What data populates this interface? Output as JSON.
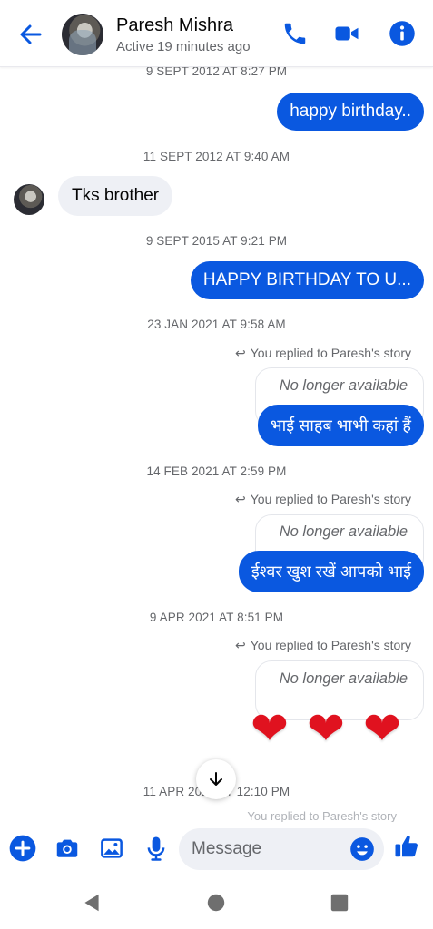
{
  "header": {
    "contact_name": "Paresh Mishra",
    "status": "Active 19 minutes ago",
    "icons": [
      "back-arrow-icon",
      "phone-icon",
      "video-camera-icon",
      "info-icon"
    ],
    "accent_color": "#0a58e0"
  },
  "messages": [
    {
      "timestamp": "9 SEPT 2012 AT 8:27 PM",
      "direction": "out",
      "text": "happy birthday.."
    },
    {
      "timestamp": "11 SEPT 2012 AT 9:40 AM",
      "direction": "in",
      "text": "Tks brother"
    },
    {
      "timestamp": "9 SEPT 2015 AT 9:21 PM",
      "direction": "out",
      "text": "HAPPY BIRTHDAY TO U..."
    },
    {
      "timestamp": "23 JAN 2021 AT 9:58 AM",
      "direction": "out",
      "reply_note": "You replied to Paresh's story",
      "story_status": "No longer available",
      "text": "भाई साहब भाभी कहां हैं"
    },
    {
      "timestamp": "14 FEB 2021 AT 2:59 PM",
      "direction": "out",
      "reply_note": "You replied to Paresh's story",
      "story_status": "No longer available",
      "text": "ईश्वर खुश रखें आपको भाई"
    },
    {
      "timestamp": "9 APR 2021 AT 8:51 PM",
      "direction": "out",
      "reply_note": "You replied to Paresh's story",
      "story_status": "No longer available",
      "text": "❤❤❤"
    },
    {
      "timestamp": "11 APR 2021 AT 12:10 PM",
      "direction": "out",
      "reply_note": "You replied to Paresh's story"
    }
  ],
  "composer": {
    "placeholder": "Message",
    "icons": [
      "add-icon",
      "camera-icon",
      "gallery-icon",
      "microphone-icon",
      "emoji-icon",
      "thumbs-up-icon"
    ]
  },
  "system_nav": {
    "icons": [
      "back-triangle-icon",
      "home-circle-icon",
      "recents-square-icon"
    ]
  }
}
